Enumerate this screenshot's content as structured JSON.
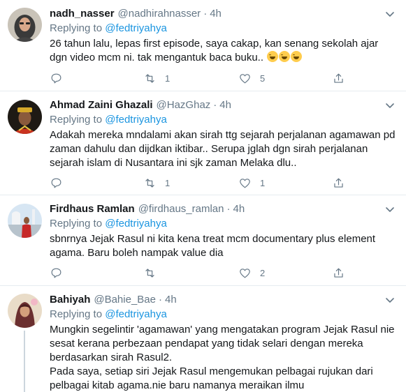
{
  "tweets": [
    {
      "name": "nadh_nasser",
      "handle": "@nadhirahnasser",
      "time": "4h",
      "replying_prefix": "Replying to",
      "replying_to": "@fedtriyahya",
      "text": [
        "26 tahun lalu, lepas first episode, saya cakap, kan senang sekolah ajar dgn video mcm ni. tak mengantuk baca buku.. "
      ],
      "emoji": [
        "sweat-smile",
        "sweat-smile",
        "sweat-smile"
      ],
      "reply_count": "",
      "retweet_count": "1",
      "like_count": "5"
    },
    {
      "name": "Ahmad Zaini Ghazali",
      "handle": "@HazGhaz",
      "time": "4h",
      "replying_prefix": "Replying to",
      "replying_to": "@fedtriyahya",
      "text": [
        "Adakah mereka mndalami akan sirah ttg sejarah perjalanan agamawan pd zaman dahulu dan dijdkan iktibar.. Serupa jglah dgn sirah perjalanan sejarah islam di Nusantara ini sjk zaman Melaka dlu.."
      ],
      "reply_count": "",
      "retweet_count": "1",
      "like_count": "1"
    },
    {
      "name": "Firdhaus Ramlan",
      "handle": "@firdhaus_ramlan",
      "time": "4h",
      "replying_prefix": "Replying to",
      "replying_to": "@fedtriyahya",
      "text": [
        "sbnrnya Jejak Rasul ni kita kena treat mcm documentary plus element agama. Baru boleh nampak value dia"
      ],
      "reply_count": "",
      "retweet_count": "",
      "like_count": "2"
    },
    {
      "name": "Bahiyah",
      "handle": "@Bahie_Bae",
      "time": "4h",
      "replying_prefix": "Replying to",
      "replying_to": "@fedtriyahya",
      "text": [
        "Mungkin segelintir 'agamawan' yang mengatakan program Jejak Rasul nie sesat kerana perbezaan pendapat yang tidak selari dengan mereka berdasarkan sirah Rasul2.",
        "Pada saya, setiap siri Jejak Rasul mengemukan pelbagai rujukan dari pelbagai kitab agama.nie baru namanya meraikan ilmu"
      ]
    }
  ],
  "colors": {
    "text": "#14171a",
    "secondary": "#657786",
    "link": "#1b95e0",
    "divider": "#e6ecf0"
  },
  "icons": {
    "reply": "reply-icon",
    "retweet": "retweet-icon",
    "like": "heart-icon",
    "share": "share-icon",
    "menu": "chevron-down-icon"
  }
}
